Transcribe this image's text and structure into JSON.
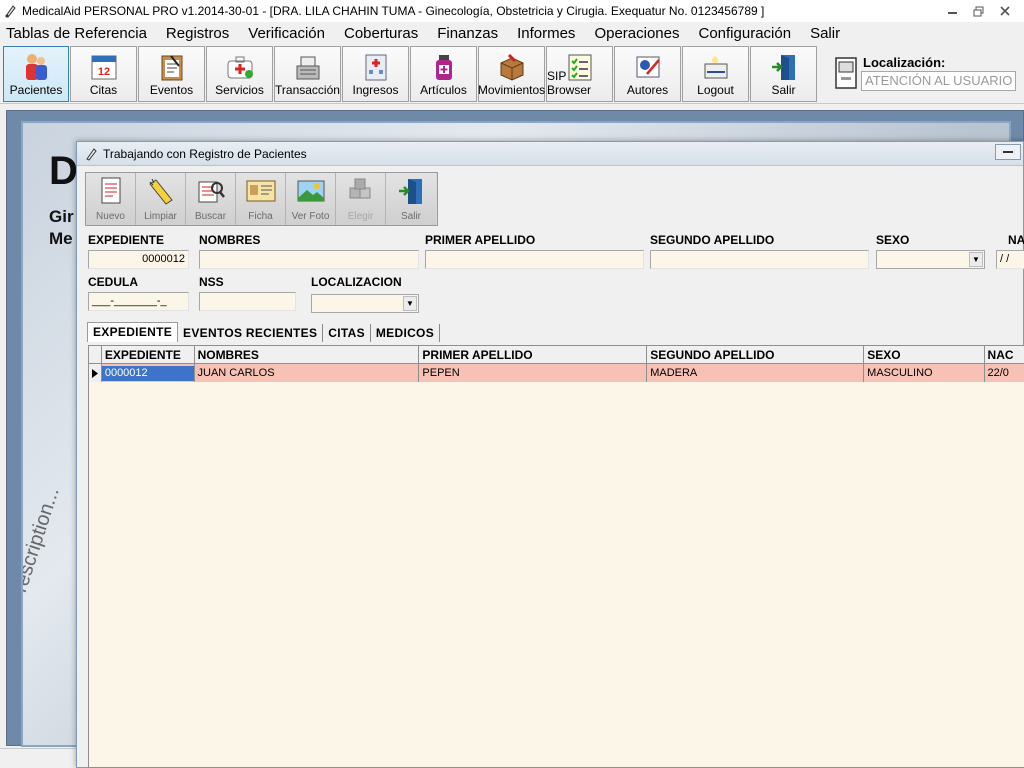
{
  "window": {
    "title": "MedicalAid PERSONAL PRO v1.2014-30-01 - [DRA. LILA CHAHIN TUMA - Ginecología, Obstetricia y Cirugia. Exequatur No. 0123456789 ]",
    "controls": [
      "minimize-icon",
      "restore-icon",
      "close-icon"
    ]
  },
  "menu": [
    {
      "label": "Tablas de Referencia"
    },
    {
      "label": "Registros"
    },
    {
      "label": "Verificación"
    },
    {
      "label": "Coberturas"
    },
    {
      "label": "Finanzas"
    },
    {
      "label": "Informes"
    },
    {
      "label": "Operaciones"
    },
    {
      "label": "Configuración"
    },
    {
      "label": "Salir"
    }
  ],
  "toolbar": [
    {
      "label": "Pacientes",
      "icon": "patients-icon"
    },
    {
      "label": "Citas",
      "icon": "calendar-icon"
    },
    {
      "label": "Eventos",
      "icon": "clipboard-icon"
    },
    {
      "label": "Servicios",
      "icon": "medkit-icon"
    },
    {
      "label": "Transacción",
      "icon": "cash-register-icon"
    },
    {
      "label": "Ingresos",
      "icon": "hospital-icon"
    },
    {
      "label": "Artículos",
      "icon": "medicine-bottle-icon"
    },
    {
      "label": "Movimientos",
      "icon": "box-icon"
    },
    {
      "label": "SIP Browser",
      "icon": "checklist-icon"
    },
    {
      "label": "Autores",
      "icon": "certificate-icon"
    },
    {
      "label": "Logout",
      "icon": "logout-icon"
    },
    {
      "label": "Salir",
      "icon": "exit-door-icon"
    }
  ],
  "location": {
    "label": "Localización:",
    "value": "ATENCIÓN AL USUARIO"
  },
  "background": {
    "big_letter": "D",
    "line1": "Gir",
    "line2": "Me",
    "watermark": "Prescription..."
  },
  "child_window": {
    "title": "Trabajando con Registro de Pacientes",
    "toolbar": [
      {
        "label": "Nuevo",
        "enabled": true
      },
      {
        "label": "Limpiar",
        "enabled": true
      },
      {
        "label": "Buscar",
        "enabled": true
      },
      {
        "label": "Ficha",
        "enabled": true
      },
      {
        "label": "Ver Foto",
        "enabled": true
      },
      {
        "label": "Elegir",
        "enabled": false
      },
      {
        "label": "Salir",
        "enabled": true
      }
    ],
    "fields": {
      "expediente": {
        "label": "EXPEDIENTE",
        "value": "0000012"
      },
      "nombres": {
        "label": "NOMBRES",
        "value": ""
      },
      "primer_apellido": {
        "label": "PRIMER APELLIDO",
        "value": ""
      },
      "segundo_apellido": {
        "label": "SEGUNDO APELLIDO",
        "value": ""
      },
      "sexo": {
        "label": "SEXO",
        "value": ""
      },
      "nacimiento": {
        "label": "NA",
        "value": "/ /"
      },
      "cedula": {
        "label": "CEDULA",
        "value": "___-_______-_"
      },
      "nss": {
        "label": "NSS",
        "value": ""
      },
      "localizacion": {
        "label": "LOCALIZACION",
        "value": ""
      }
    },
    "tabs": [
      "EXPEDIENTE",
      "EVENTOS RECIENTES",
      "CITAS",
      "MEDICOS"
    ],
    "grid": {
      "columns": [
        "EXPEDIENTE",
        "NOMBRES",
        "PRIMER APELLIDO",
        "SEGUNDO APELLIDO",
        "SEXO",
        "NAC"
      ],
      "rows": [
        [
          "0000012",
          "JUAN CARLOS",
          "PEPEN",
          "MADERA",
          "MASCULINO",
          "22/0"
        ]
      ]
    }
  },
  "colors": {
    "row_highlight": "#f7c1b6",
    "selected_cell": "#3d74c9",
    "field_bg": "#fcf6e8"
  }
}
